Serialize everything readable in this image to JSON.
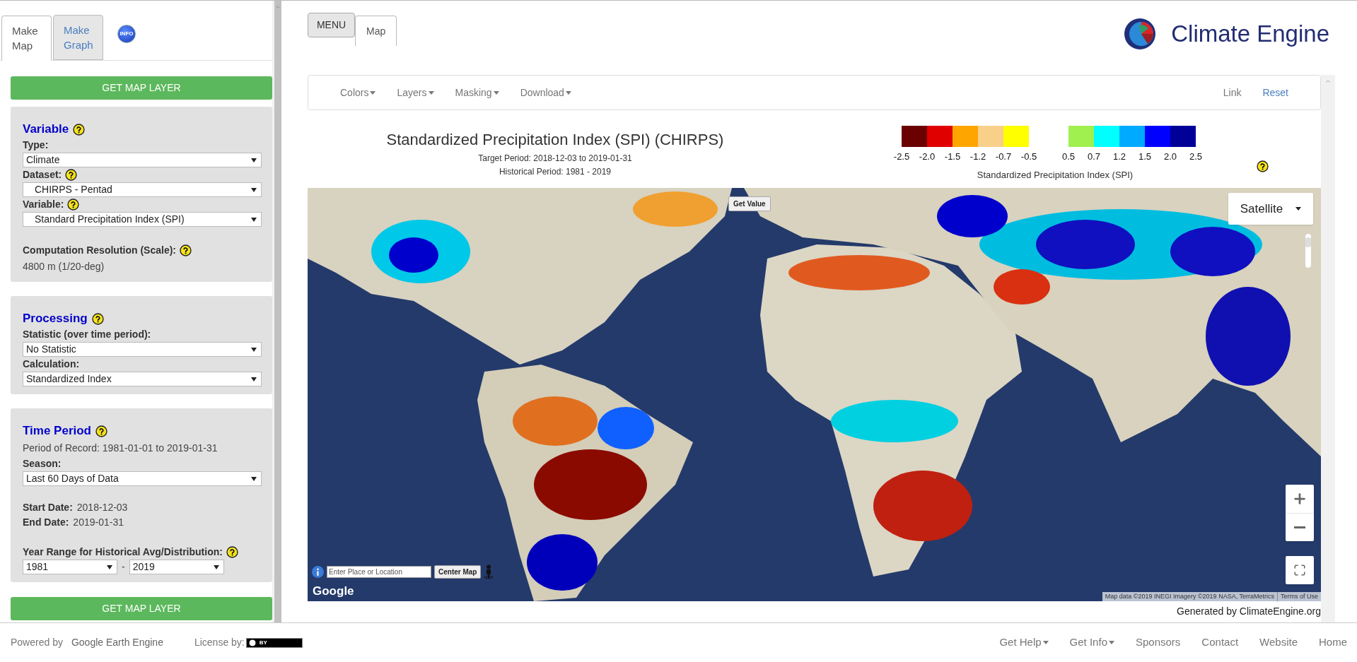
{
  "sidebar": {
    "tabs": [
      {
        "label": "Make Map",
        "selected": true
      },
      {
        "label": "Make Graph",
        "selected": false
      }
    ],
    "info_button": "INFO",
    "top_button": "GET MAP LAYER",
    "panels": [
      {
        "title": "Variable",
        "help": true,
        "fields": [
          {
            "kind": "select",
            "label": "Type:",
            "help": false,
            "value": "Climate",
            "indent": false
          },
          {
            "kind": "select",
            "label": "Dataset:",
            "help": true,
            "value": "CHIRPS - Pentad",
            "indent": true
          },
          {
            "kind": "select",
            "label": "Variable:",
            "help": true,
            "value": "Standard Precipitation Index (SPI)",
            "indent": true
          },
          {
            "kind": "readout",
            "label": "Computation Resolution (Scale):",
            "help": true,
            "value": "4800 m (1/20-deg)"
          }
        ]
      },
      {
        "title": "Processing",
        "help": true,
        "fields": [
          {
            "kind": "select",
            "label": "Statistic (over time period):",
            "help": false,
            "value": "No Statistic",
            "indent": false
          },
          {
            "kind": "select",
            "label": "Calculation:",
            "help": false,
            "value": "Standardized Index",
            "indent": false
          }
        ]
      },
      {
        "title": "Time Period",
        "help": true,
        "fields": [
          {
            "kind": "note",
            "value": "Period of Record: 1981-01-01 to 2019-01-31"
          },
          {
            "kind": "select",
            "label": "Season:",
            "help": false,
            "value": "Last 60 Days of Data",
            "indent": false
          },
          {
            "kind": "date",
            "label": "Start Date:",
            "value": "2018-12-03"
          },
          {
            "kind": "date",
            "label": "End Date:",
            "value": "2019-01-31"
          },
          {
            "kind": "range",
            "label": "Year Range for Historical Avg/Distribution:",
            "help": true,
            "from": "1981",
            "separator": "-",
            "to": "2019"
          }
        ]
      }
    ],
    "bottom_button": "GET MAP LAYER"
  },
  "header": {
    "menu_button": "MENU",
    "tabs": [
      {
        "label": "Map",
        "selected": true
      }
    ],
    "logo": "Climate Engine"
  },
  "toolbar": {
    "items": [
      {
        "label": "Colors",
        "kind": "dropdown"
      },
      {
        "label": "Layers",
        "kind": "dropdown"
      },
      {
        "label": "Masking",
        "kind": "dropdown"
      },
      {
        "label": "Download",
        "kind": "dropdown"
      },
      {
        "label": "Link",
        "kind": "link"
      },
      {
        "label": "Reset",
        "kind": "action"
      }
    ]
  },
  "map_title": {
    "title": "Standardized Precipitation Index (SPI) (CHIRPS)",
    "lines": [
      "Target Period: 2018-12-03 to 2019-01-31",
      "Historical Period: 1981 - 2019"
    ]
  },
  "legend": {
    "groups": [
      {
        "swatches": [
          {
            "color": "#6b0000"
          },
          {
            "color": "#e00000"
          },
          {
            "color": "#ffa500"
          },
          {
            "color": "#f9d08a"
          },
          {
            "color": "#ffff00"
          }
        ],
        "ticks": [
          "-2.5",
          "-2.0",
          "-1.5",
          "-1.2",
          "-0.7",
          "-0.5"
        ]
      },
      {
        "swatches": [
          {
            "color": "#a0f050"
          },
          {
            "color": "#00ffff"
          },
          {
            "color": "#00aaff"
          },
          {
            "color": "#0000ff"
          },
          {
            "color": "#000099"
          }
        ],
        "ticks": [
          "0.5",
          "0.7",
          "1.2",
          "1.5",
          "2.0",
          "2.5"
        ]
      }
    ],
    "caption": "Standardized Precipitation Index (SPI)",
    "help": true
  },
  "map": {
    "zoom": {
      "level": 0.15
    },
    "get_value": "Get Value",
    "map_type": "Satellite",
    "search_placeholder": "Enter Place or Location",
    "center_button": "Center Map",
    "google_logo": "Google",
    "attribution": "Map data ©2019 INEGI Imagery ©2019 NASA, TerraMetrics",
    "terms": "Terms of Use"
  },
  "generated_by": "Generated by ClimateEngine.org",
  "footer": {
    "powered_by": "Powered by",
    "engine": "Google Earth Engine",
    "license": "License by:",
    "license_badge": "BY",
    "links": [
      {
        "label": "Get Help",
        "kind": "dropdown"
      },
      {
        "label": "Get Info",
        "kind": "dropdown"
      },
      {
        "label": "Sponsors",
        "kind": "link"
      },
      {
        "label": "Contact",
        "kind": "link"
      },
      {
        "label": "Website",
        "kind": "link"
      },
      {
        "label": "Home",
        "kind": "link"
      }
    ]
  }
}
